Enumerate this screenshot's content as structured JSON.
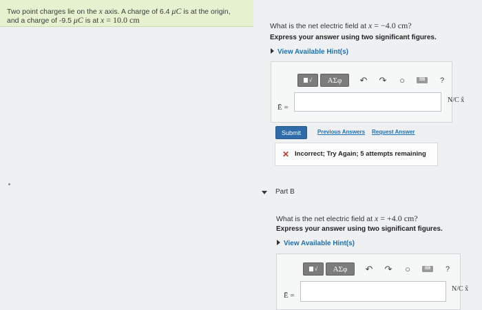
{
  "problem": {
    "line1_prefix": "Two point charges lie on the",
    "axis_var": "x",
    "line1_mid": "axis. A charge of 6.4",
    "unit_uC": "μC",
    "line1_suffix": "is at the origin,",
    "line2_prefix": "and a charge of -9.5",
    "line2_mid": "is at",
    "pos_var": "x",
    "eq": "=",
    "pos_value": "10.0 cm"
  },
  "part_a": {
    "question_prefix": "What is the net electric field at",
    "var": "x",
    "eq": "=",
    "value": "−4.0 cm?",
    "instruction": "Express your answer using two significant figures.",
    "hints": "View Available Hint(s)",
    "label": "Ē =",
    "unit": "N/C x̂",
    "submit": "Submit",
    "previous": "Previous Answers",
    "request": "Request Answer",
    "feedback_icon": "✕",
    "feedback": "Incorrect; Try Again; 5 attempts remaining"
  },
  "part_b": {
    "title": "Part B",
    "question_prefix": "What is the net electric field at",
    "var": "x",
    "eq": "=",
    "value": "+4.0 cm?",
    "instruction": "Express your answer using two significant figures.",
    "hints": "View Available Hint(s)",
    "label": "Ē =",
    "unit": "N/C x̂"
  },
  "toolbar": {
    "templates_glyph": "√",
    "greek": "ΑΣφ",
    "undo": "↶",
    "redo": "↷",
    "reset": "○",
    "keyboard": "⌨",
    "help": "?"
  },
  "icons": [
    "templates-icon",
    "greek-icon",
    "undo-icon",
    "redo-icon",
    "reset-icon",
    "keyboard-icon",
    "help-icon",
    "incorrect-icon",
    "caret-down-icon",
    "hint-caret-icon"
  ],
  "colors": {
    "problem_bg": "#e6f2cf",
    "submit_bg": "#2f6aa9",
    "link": "#1b6fb4",
    "error": "#c0392b"
  }
}
